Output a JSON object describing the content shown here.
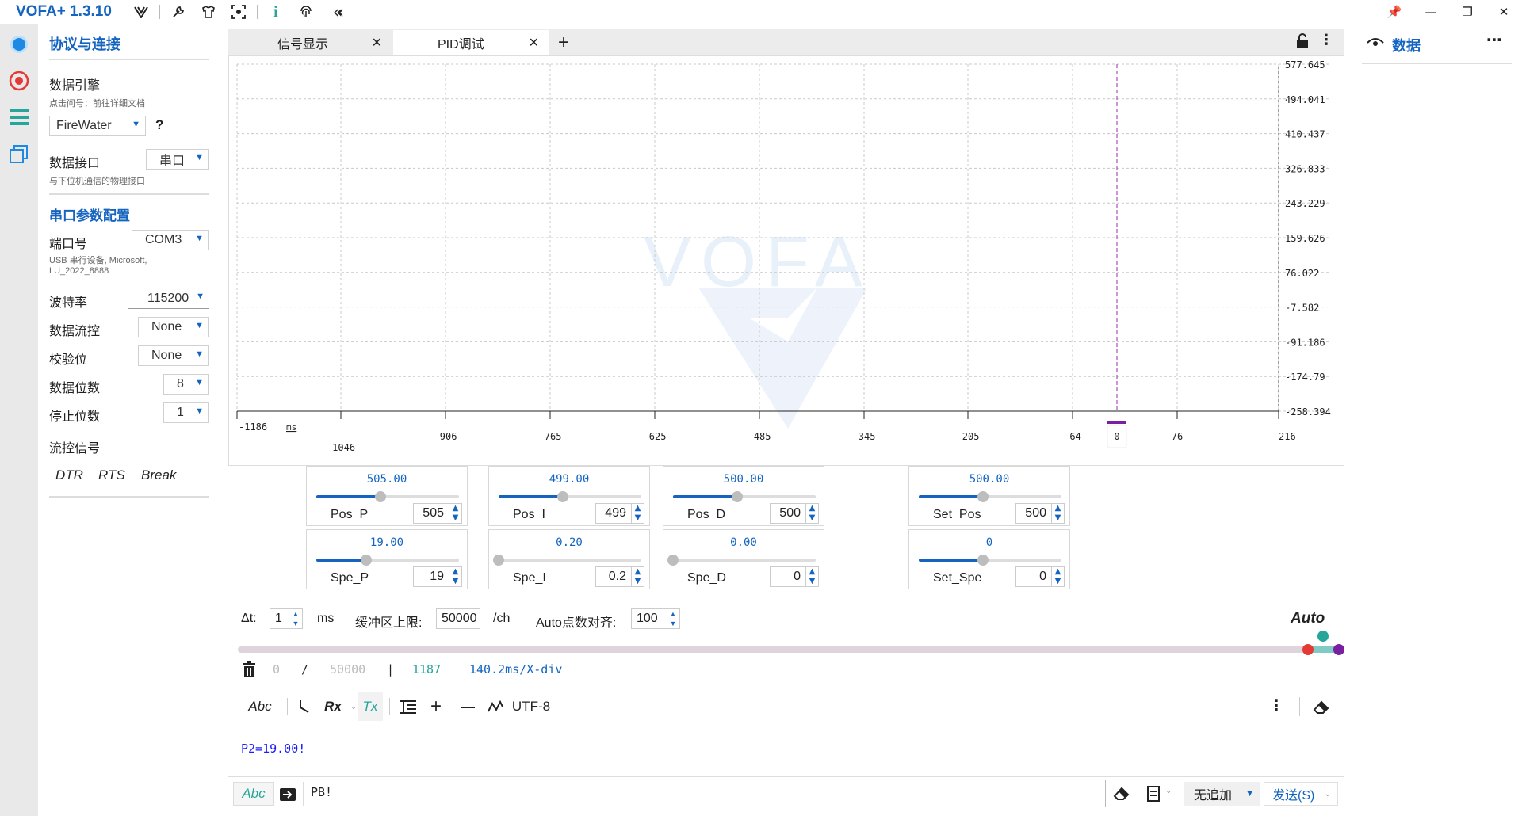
{
  "titlebar": {
    "app_title": "VOFA+ 1.3.10",
    "icons": [
      "vofa-logo-icon",
      "wrench-icon",
      "shirt-icon",
      "screenshot-icon",
      "info-icon",
      "fingerprint-icon",
      "collapse-icon"
    ],
    "window_buttons": [
      "pin-icon",
      "minimize-icon",
      "restore-icon",
      "close-icon"
    ]
  },
  "rail": {
    "icons": [
      "connection-icon",
      "record-icon",
      "list-icon",
      "windows-icon"
    ]
  },
  "settings": {
    "title": "协议与连接",
    "engine_label": "数据引擎",
    "engine_hint": "点击问号：前往详细文档",
    "engine_value": "FireWater",
    "engine_help": "?",
    "interface_label": "数据接口",
    "interface_value": "串口",
    "interface_hint": "与下位机通信的物理接口",
    "serial_head": "串口参数配置",
    "port_label": "端口号",
    "port_value": "COM3",
    "port_hint1": "USB 串行设备, Microsoft,",
    "port_hint2": "LU_2022_8888",
    "baud_label": "波特率",
    "baud_value": "115200",
    "flowctl_label": "数据流控",
    "flowctl_value": "None",
    "parity_label": "校验位",
    "parity_value": "None",
    "databits_label": "数据位数",
    "databits_value": "8",
    "stopbits_label": "停止位数",
    "stopbits_value": "1",
    "flowsig_label": "流控信号",
    "dtr": "DTR",
    "rts": "RTS",
    "brk": "Break"
  },
  "tabs": [
    {
      "label": "信号显示",
      "close": "✕"
    },
    {
      "label": "PID调试",
      "close": "✕"
    }
  ],
  "tab_add": "+",
  "chart_data": {
    "type": "line",
    "y_ticks": [
      "577.645",
      "494.041",
      "410.437",
      "326.833",
      "243.229",
      "159.626",
      "76.022",
      "-7.582",
      "-91.186",
      "-174.79",
      "-258.394"
    ],
    "x_ticks_upper": [
      "-1186"
    ],
    "x_unit": "ms",
    "x_ticks": [
      "-1046",
      "-906",
      "-765",
      "-625",
      "-485",
      "-345",
      "-205",
      "-64",
      "0",
      "76",
      "216"
    ],
    "cursor_x": 0,
    "watermark": "VOFA",
    "series": []
  },
  "widgets": [
    {
      "display": "505.00",
      "name": "Pos_P",
      "value": "505",
      "fraction": 0.45
    },
    {
      "display": "499.00",
      "name": "Pos_I",
      "value": "499",
      "fraction": 0.45
    },
    {
      "display": "500.00",
      "name": "Pos_D",
      "value": "500",
      "fraction": 0.45
    },
    {
      "display": "500.00",
      "name": "Set_Pos",
      "value": "500",
      "fraction": 0.45
    },
    {
      "display": "19.00",
      "name": "Spe_P",
      "value": "19",
      "fraction": 0.35
    },
    {
      "display": "0.20",
      "name": "Spe_I",
      "value": "0.2",
      "fraction": 0.0
    },
    {
      "display": "0.00",
      "name": "Spe_D",
      "value": "0",
      "fraction": 0.0
    },
    {
      "display": "0",
      "name": "Set_Spe",
      "value": "0",
      "fraction": 0.45
    }
  ],
  "controls": {
    "dt_label": "Δt:",
    "dt_value": "1",
    "dt_unit": "ms",
    "buffer_label": "缓冲区上限:",
    "buffer_value": "50000",
    "buffer_unit": "/ch",
    "auto_align_label": "Auto点数对齐:",
    "auto_align_value": "100",
    "auto_label": "Auto"
  },
  "stats": {
    "count": "0",
    "sep1": "/",
    "limit": "50000",
    "sep2": "|",
    "points": "1187",
    "xdiv": "140.2ms/X-div"
  },
  "toolbar": {
    "abc": "Abc",
    "rx": "Rx",
    "tx": "Tx",
    "plus": "+",
    "minus": "—",
    "encoding": "UTF-8"
  },
  "rx_text": "P2=19.00!",
  "send": {
    "abc": "Abc",
    "input_value": "PB!",
    "append_value": "无追加",
    "send_label": "发送(S)"
  },
  "right_panel": {
    "title": "数据"
  },
  "colors": {
    "accent": "#1565c0",
    "cursor": "#9c27b0",
    "teal": "#26a69a",
    "red": "#e53935"
  }
}
